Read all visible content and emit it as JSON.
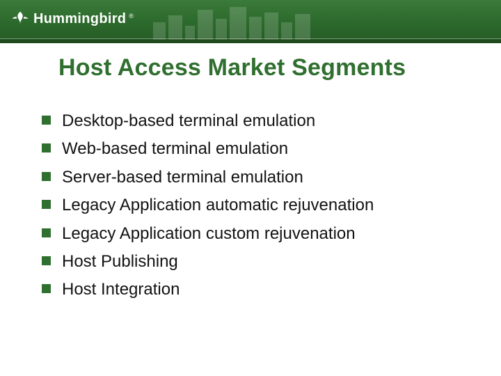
{
  "brand": {
    "name": "Hummingbird",
    "registered_mark": "®",
    "accent_color": "#2f6f2f"
  },
  "title": "Host Access Market Segments",
  "bullets": [
    "Desktop-based terminal emulation",
    "Web-based terminal emulation",
    "Server-based terminal emulation",
    "Legacy Application automatic rejuvenation",
    "Legacy Application custom rejuvenation",
    "Host Publishing",
    "Host Integration"
  ]
}
